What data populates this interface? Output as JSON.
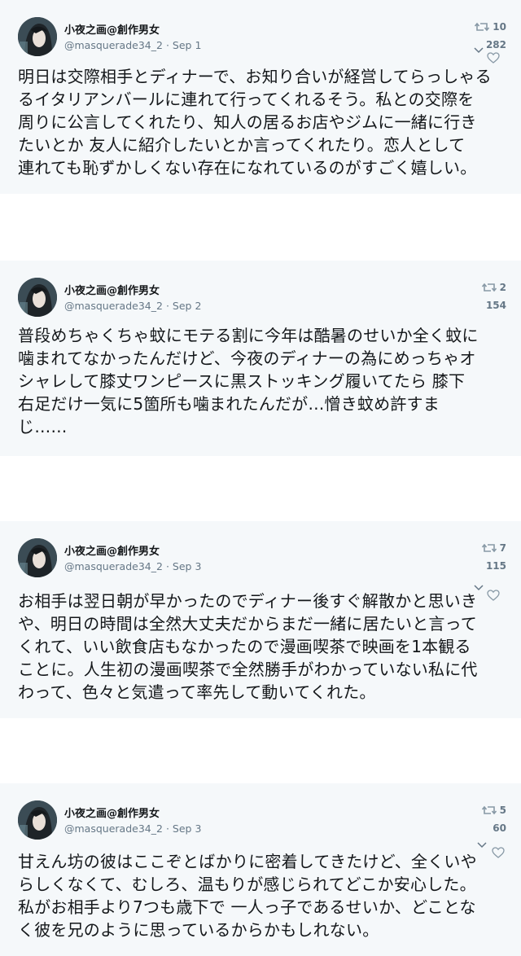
{
  "tweets": [
    {
      "name": "小夜之画@創作男女",
      "handle": "@masquerade34_2",
      "sep": "·",
      "date": "Sep 1",
      "retweets": "10",
      "likes": "282",
      "text": "明日は交際相手とディナーで、お知り合いが経営してらっしゃる\nるイタリアンバールに連れて行ってくれるそう。私との交際を\n周りに公言してくれたり、知人の居るお店やジムに一緒に行き\nたいとか 友人に紹介したいとか言ってくれたり。恋人として\n連れても恥ずかしくない存在になれているのがすごく嬉しい。"
    },
    {
      "name": "小夜之画@創作男女",
      "handle": "@masquerade34_2",
      "sep": "·",
      "date": "Sep 2",
      "retweets": "2",
      "likes": "154",
      "text": "普段めちゃくちゃ蚊にモテる割に今年は酷暑のせいか全く蚊に\n噛まれてなかったんだけど、今夜のディナーの為にめっちゃオ\nシャレして膝丈ワンピースに黒ストッキング履いてたら 膝下\n右足だけ一気に5箇所も噛まれたんだが…憎き蚊め許すま\nじ……"
    },
    {
      "name": "小夜之画@創作男女",
      "handle": "@masquerade34_2",
      "sep": "·",
      "date": "Sep 3",
      "retweets": "7",
      "likes": "115",
      "text": "お相手は翌日朝が早かったのでディナー後すぐ解散かと思いき\nや、明日の時間は全然大丈夫だからまだ一緒に居たいと言って\nくれて、いい飲食店もなかったので漫画喫茶で映画を1本観る\nことに。人生初の漫画喫茶で全然勝手がわかっていない私に代\nわって、色々と気遣って率先して動いてくれた。"
    },
    {
      "name": "小夜之画@創作男女",
      "handle": "@masquerade34_2",
      "sep": "·",
      "date": "Sep 3",
      "retweets": "5",
      "likes": "60",
      "text": "甘えん坊の彼はここぞとばかりに密着してきたけど、全くいや\nらしくなくて、むしろ、温もりが感じられてどこか安心した。\n私がお相手より7つも歳下で 一人っ子であるせいか、どことな\nく彼を兄のように思っているからかもしれない。"
    }
  ]
}
